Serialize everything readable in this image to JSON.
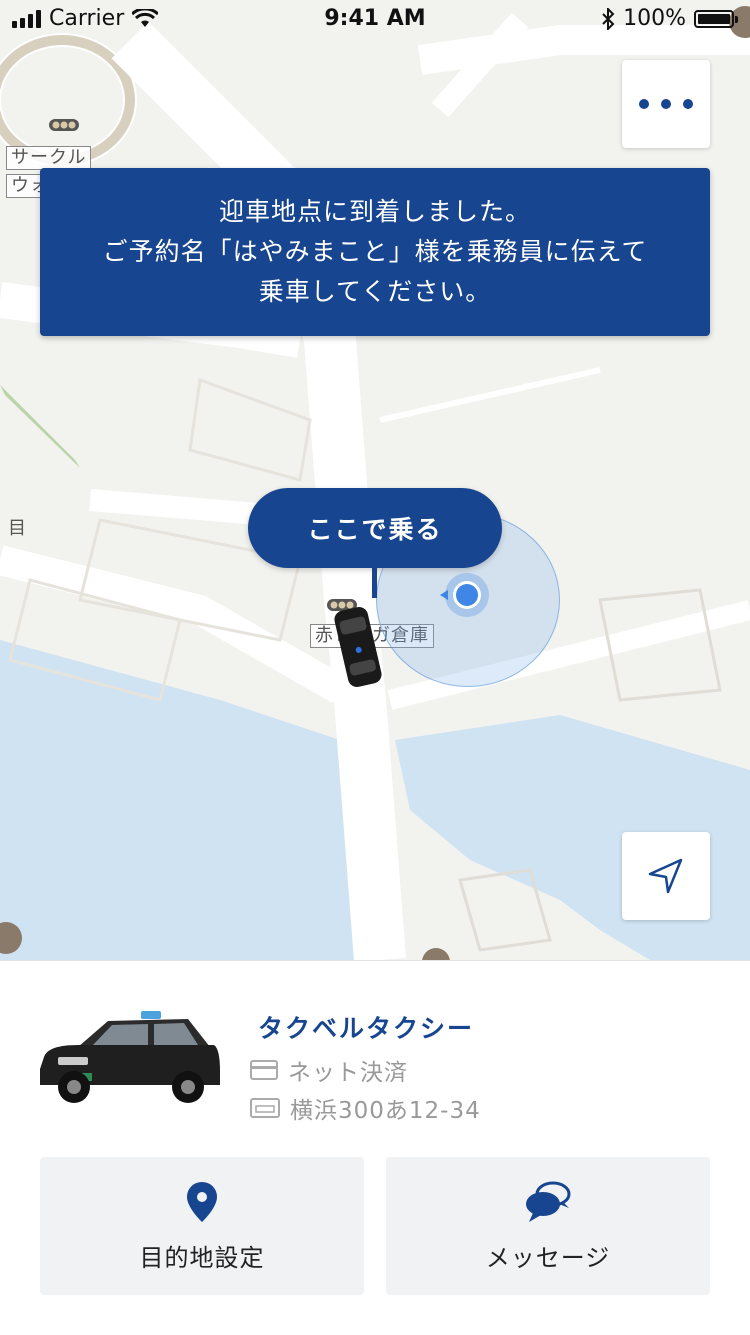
{
  "status_bar": {
    "carrier": "Carrier",
    "time": "9:41 AM",
    "battery_text": "100%",
    "battery_level": 1.0
  },
  "map": {
    "labels": [
      "サークル",
      "ウォ",
      "赤レンガ倉庫",
      "目"
    ]
  },
  "banner": {
    "line1": "迎車地点に到着しました。",
    "line2": "ご予約名「はやみまこと」様を乗務員に伝えて",
    "line3": "乗車してください。"
  },
  "pickup": {
    "label": "ここで乗る"
  },
  "taxi": {
    "company": "タクベルタクシー",
    "payment": "ネット決済",
    "plate": "横浜300あ12-34"
  },
  "actions": {
    "destination_label": "目的地設定",
    "message_label": "メッセージ"
  },
  "colors": {
    "brand": "#17458f",
    "water": "#cfe3f2",
    "land": "#f2f2ef",
    "road": "#ffffff"
  },
  "icons": {
    "more": "more-dots-icon",
    "locate": "navigation-arrow-icon",
    "payment": "credit-card-icon",
    "plate": "license-plate-icon",
    "destination": "location-pin-icon",
    "message": "chat-bubbles-icon"
  }
}
